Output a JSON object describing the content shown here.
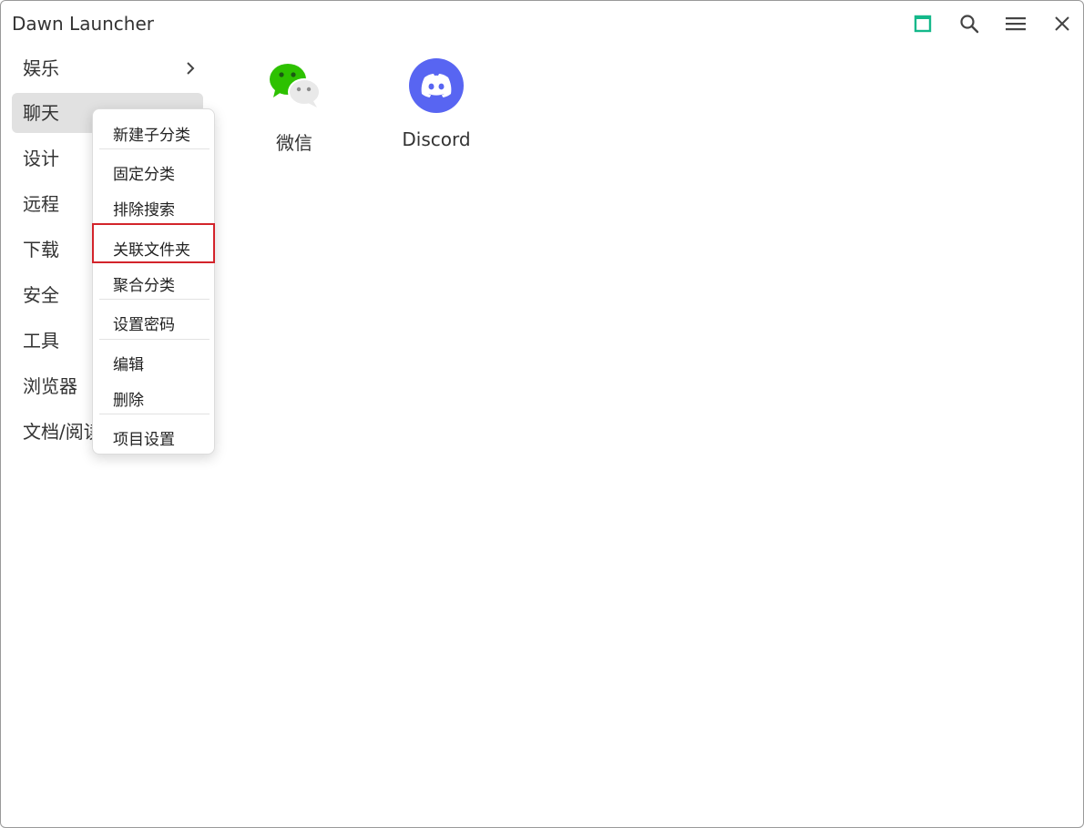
{
  "app": {
    "title": "Dawn Launcher"
  },
  "titlebar": {
    "icons": [
      "maximize-icon",
      "search-icon",
      "menu-icon",
      "close-icon"
    ],
    "accent": "#14b88a"
  },
  "sidebar": {
    "items": [
      {
        "label": "娱乐",
        "has_children": true
      },
      {
        "label": "聊天",
        "active": true
      },
      {
        "label": "设计"
      },
      {
        "label": "远程"
      },
      {
        "label": "下载"
      },
      {
        "label": "安全"
      },
      {
        "label": "工具"
      },
      {
        "label": "浏览器"
      },
      {
        "label": "文档/阅读"
      }
    ]
  },
  "apps": [
    {
      "name": "微信",
      "icon": "wechat-icon",
      "color": "#2dc100"
    },
    {
      "name": "Discord",
      "icon": "discord-icon",
      "color": "#5865f2"
    }
  ],
  "context_menu": {
    "items": [
      "新建子分类",
      "固定分类",
      "排除搜索",
      "关联文件夹",
      "聚合分类",
      "设置密码",
      "编辑",
      "删除",
      "项目设置"
    ],
    "highlighted": "关联文件夹",
    "highlight_color": "#d3242b"
  }
}
